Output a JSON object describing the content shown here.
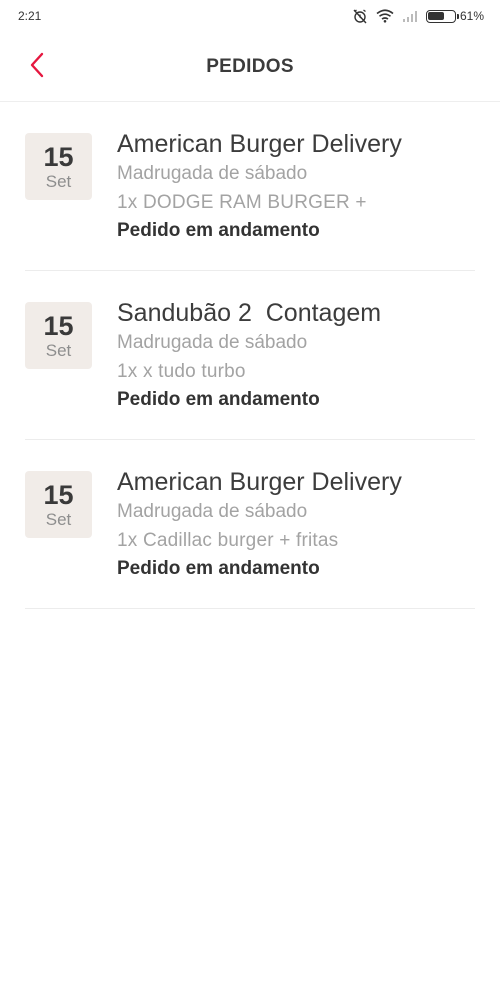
{
  "status_bar": {
    "time": "2:21",
    "battery_percent": "61%",
    "battery_level": 0.61
  },
  "header": {
    "title": "PEDIDOS",
    "back_icon": "chevron-left-icon",
    "accent_color": "#e5173f"
  },
  "orders": [
    {
      "day": "15",
      "month": "Set",
      "restaurant": "American Burger Delivery",
      "time": "Madrugada de sábado",
      "items": "1x DODGE RAM BURGER +",
      "status": "Pedido em andamento"
    },
    {
      "day": "15",
      "month": "Set",
      "restaurant": "Sandubão 2  Contagem",
      "time": "Madrugada de sábado",
      "items": "1x x tudo turbo",
      "status": "Pedido em andamento"
    },
    {
      "day": "15",
      "month": "Set",
      "restaurant": "American Burger Delivery",
      "time": "Madrugada de sábado",
      "items": "1x Cadillac burger + fritas",
      "status": "Pedido em andamento"
    }
  ]
}
